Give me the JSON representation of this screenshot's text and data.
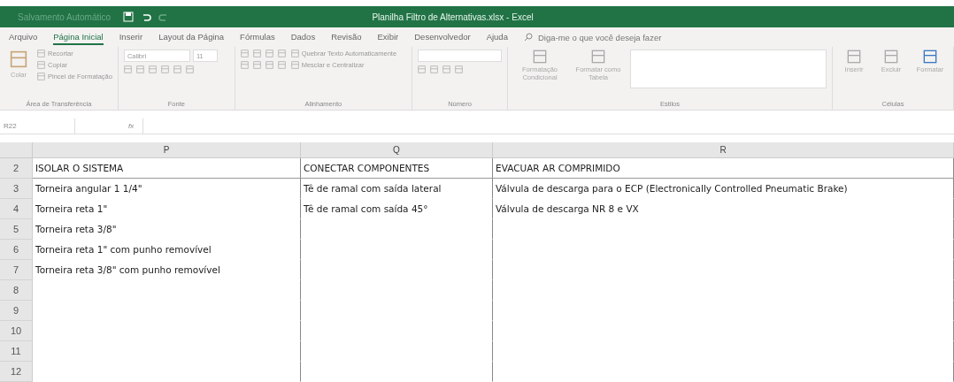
{
  "window": {
    "title": "Planilha Filtro de Alternativas.xlsx - Excel",
    "autosave": "Salvamento Automático"
  },
  "menu_tabs": [
    {
      "label": "Arquivo",
      "selected": false
    },
    {
      "label": "Página Inicial",
      "selected": true
    },
    {
      "label": "Inserir",
      "selected": false
    },
    {
      "label": "Layout da Página",
      "selected": false
    },
    {
      "label": "Fórmulas",
      "selected": false
    },
    {
      "label": "Dados",
      "selected": false
    },
    {
      "label": "Revisão",
      "selected": false
    },
    {
      "label": "Exibir",
      "selected": false
    },
    {
      "label": "Desenvolvedor",
      "selected": false
    },
    {
      "label": "Ajuda",
      "selected": false
    }
  ],
  "tell_me": {
    "placeholder": "Diga-me o que você deseja fazer"
  },
  "ribbon": {
    "clipboard": {
      "paste": "Colar",
      "cut": "Recortar",
      "copy": "Copiar",
      "format_painter": "Pincel de Formatação",
      "label": "Área de Transferência"
    },
    "font": {
      "name": "Calibri",
      "size": "11",
      "label": "Fonte"
    },
    "alignment": {
      "wrap": "Quebrar Texto Automaticamente",
      "merge": "Mesclar e Centralizar",
      "label": "Alinhamento"
    },
    "number": {
      "label": "Número"
    },
    "styles": {
      "conditional": "Formatação Condicional",
      "table": "Formatar como Tabela",
      "label": "Estilos"
    },
    "cells": {
      "insert": "Inserir",
      "delete": "Excluir",
      "format": "Formatar",
      "label": "Células"
    }
  },
  "formula_bar": {
    "name_box": "R22",
    "fx": "fx"
  },
  "sheet": {
    "columns": [
      "P",
      "Q",
      "R"
    ],
    "rows": [
      {
        "number": "2",
        "cells": [
          "ISOLAR O SISTEMA",
          "CONECTAR COMPONENTES",
          "EVACUAR AR COMPRIMIDO"
        ]
      },
      {
        "number": "3",
        "cells": [
          "Torneira angular 1 1/4\"",
          "Tê de ramal com saída lateral",
          "Válvula de descarga para o ECP (Electronically Controlled Pneumatic Brake)"
        ]
      },
      {
        "number": "4",
        "cells": [
          "Torneira reta 1\"",
          "Tê de ramal com saída 45°",
          "Válvula de descarga NR 8 e VX"
        ]
      },
      {
        "number": "5",
        "cells": [
          "Torneira reta 3/8\"",
          "",
          ""
        ]
      },
      {
        "number": "6",
        "cells": [
          "Torneira reta 1\" com punho removível",
          "",
          ""
        ]
      },
      {
        "number": "7",
        "cells": [
          "Torneira reta 3/8\" com punho removível",
          "",
          ""
        ]
      },
      {
        "number": "8",
        "cells": [
          "",
          "",
          ""
        ]
      },
      {
        "number": "9",
        "cells": [
          "",
          "",
          ""
        ]
      },
      {
        "number": "10",
        "cells": [
          "",
          "",
          ""
        ]
      },
      {
        "number": "11",
        "cells": [
          "",
          "",
          ""
        ]
      },
      {
        "number": "12",
        "cells": [
          "",
          "",
          ""
        ]
      }
    ]
  }
}
